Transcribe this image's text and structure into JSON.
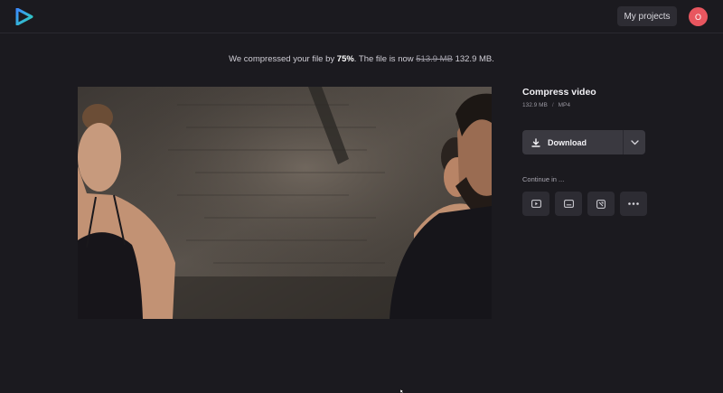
{
  "header": {
    "my_projects_label": "My projects",
    "avatar_initial": "O"
  },
  "notice": {
    "prefix": "We compressed your file by ",
    "percent": "75%",
    "middle": ". The file is now ",
    "old_size": "513.9 MB",
    "new_size": "132.9 MB."
  },
  "sidebar": {
    "title": "Compress video",
    "file_size": "132.9 MB",
    "separator": "/",
    "format": "MP4",
    "download_label": "Download",
    "continue_label": "Continue in ..."
  },
  "continue_icons": [
    "video-app-icon",
    "subtitle-app-icon",
    "edit-app-icon",
    "more-icon"
  ],
  "colors": {
    "background": "#1b1a1f",
    "button": "#2d2c33",
    "download": "#3a3940",
    "avatar": "#e8565f",
    "logo_blue": "#3b8bff",
    "logo_teal": "#2fd4b5"
  }
}
